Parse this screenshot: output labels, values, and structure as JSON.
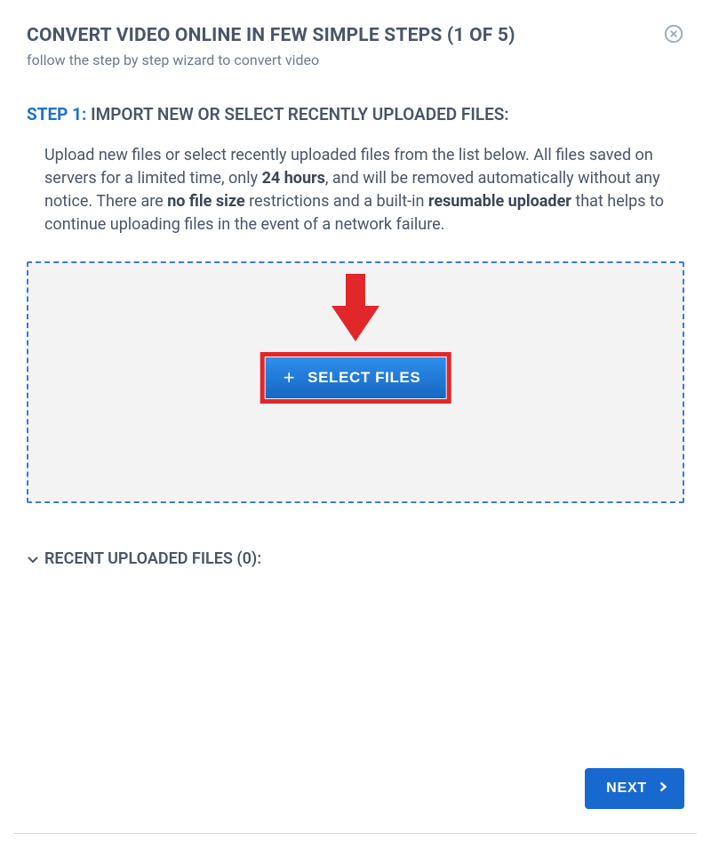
{
  "header": {
    "title": "CONVERT VIDEO ONLINE IN FEW SIMPLE STEPS (1 OF 5)",
    "subtitle": "follow the step by step wizard to convert video"
  },
  "step": {
    "label": "STEP 1:",
    "heading": "IMPORT NEW OR SELECT RECENTLY UPLOADED FILES:"
  },
  "description": {
    "part1": "Upload new files or select recently uploaded files from the list below. All files saved on servers for a limited time, only ",
    "bold1": "24 hours",
    "part2": ", and will be removed automatically without any notice. There are ",
    "bold2": "no file size",
    "part3": " restrictions and a built-in ",
    "bold3": "resumable uploader",
    "part4": " that helps to continue uploading files in the event of a network failure."
  },
  "dropzone": {
    "select_label": "SELECT FILES"
  },
  "recent": {
    "label": "RECENT UPLOADED FILES (0):"
  },
  "footer": {
    "next_label": "NEXT"
  }
}
